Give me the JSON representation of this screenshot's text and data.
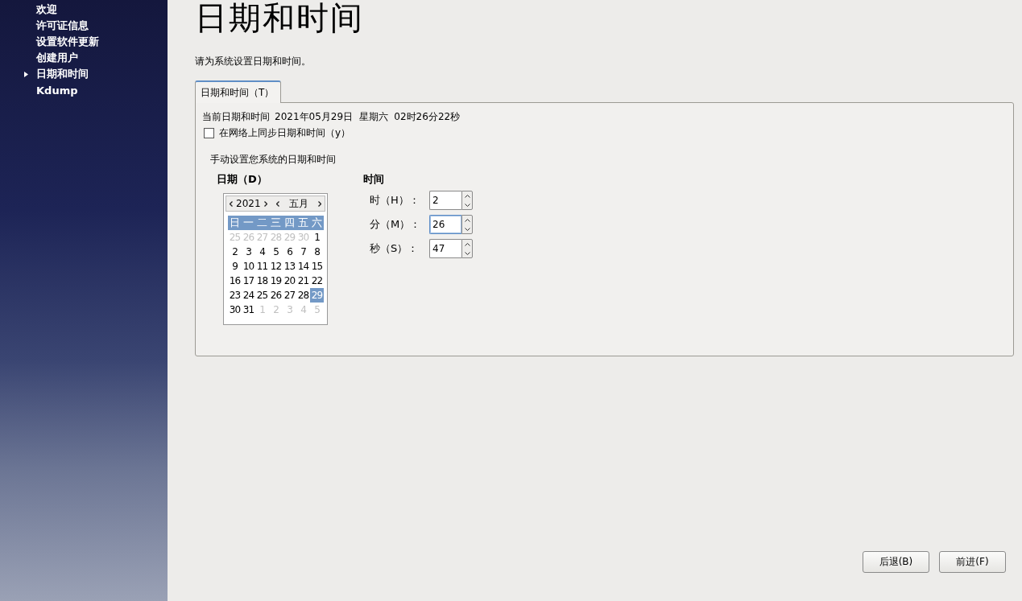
{
  "sidebar": {
    "items": [
      {
        "label": "欢迎",
        "selected": false
      },
      {
        "label": "许可证信息",
        "selected": false
      },
      {
        "label": "设置软件更新",
        "selected": false
      },
      {
        "label": "创建用户",
        "selected": false
      },
      {
        "label": "日期和时间",
        "selected": true
      },
      {
        "label": "Kdump",
        "selected": false
      }
    ]
  },
  "title": "日期和时间",
  "subtitle": "请为系统设置日期和时间。",
  "tabs": [
    {
      "label": "日期和时间（T）",
      "selected": true
    }
  ],
  "current": {
    "label": "当前日期和时间",
    "value": "2021年05月29日  星期六  02时26分22秒"
  },
  "sync": {
    "label": "在网络上同步日期和时间（y）",
    "checked": false
  },
  "manual_label": "手动设置您系统的日期和时间",
  "date": {
    "heading": "日期（D）",
    "year": "2021",
    "month": "五月",
    "weekdays": [
      "日",
      "一",
      "二",
      "三",
      "四",
      "五",
      "六"
    ],
    "days": [
      {
        "day": "25",
        "other": true,
        "selected": false
      },
      {
        "day": "26",
        "other": true,
        "selected": false
      },
      {
        "day": "27",
        "other": true,
        "selected": false
      },
      {
        "day": "28",
        "other": true,
        "selected": false
      },
      {
        "day": "29",
        "other": true,
        "selected": false
      },
      {
        "day": "30",
        "other": true,
        "selected": false
      },
      {
        "day": "1",
        "other": false,
        "selected": false
      },
      {
        "day": "2",
        "other": false,
        "selected": false
      },
      {
        "day": "3",
        "other": false,
        "selected": false
      },
      {
        "day": "4",
        "other": false,
        "selected": false
      },
      {
        "day": "5",
        "other": false,
        "selected": false
      },
      {
        "day": "6",
        "other": false,
        "selected": false
      },
      {
        "day": "7",
        "other": false,
        "selected": false
      },
      {
        "day": "8",
        "other": false,
        "selected": false
      },
      {
        "day": "9",
        "other": false,
        "selected": false
      },
      {
        "day": "10",
        "other": false,
        "selected": false
      },
      {
        "day": "11",
        "other": false,
        "selected": false
      },
      {
        "day": "12",
        "other": false,
        "selected": false
      },
      {
        "day": "13",
        "other": false,
        "selected": false
      },
      {
        "day": "14",
        "other": false,
        "selected": false
      },
      {
        "day": "15",
        "other": false,
        "selected": false
      },
      {
        "day": "16",
        "other": false,
        "selected": false
      },
      {
        "day": "17",
        "other": false,
        "selected": false
      },
      {
        "day": "18",
        "other": false,
        "selected": false
      },
      {
        "day": "19",
        "other": false,
        "selected": false
      },
      {
        "day": "20",
        "other": false,
        "selected": false
      },
      {
        "day": "21",
        "other": false,
        "selected": false
      },
      {
        "day": "22",
        "other": false,
        "selected": false
      },
      {
        "day": "23",
        "other": false,
        "selected": false
      },
      {
        "day": "24",
        "other": false,
        "selected": false
      },
      {
        "day": "25",
        "other": false,
        "selected": false
      },
      {
        "day": "26",
        "other": false,
        "selected": false
      },
      {
        "day": "27",
        "other": false,
        "selected": false
      },
      {
        "day": "28",
        "other": false,
        "selected": false
      },
      {
        "day": "29",
        "other": false,
        "selected": true
      },
      {
        "day": "30",
        "other": false,
        "selected": false
      },
      {
        "day": "31",
        "other": false,
        "selected": false
      },
      {
        "day": "1",
        "other": true,
        "selected": false
      },
      {
        "day": "2",
        "other": true,
        "selected": false
      },
      {
        "day": "3",
        "other": true,
        "selected": false
      },
      {
        "day": "4",
        "other": true,
        "selected": false
      },
      {
        "day": "5",
        "other": true,
        "selected": false
      }
    ]
  },
  "time": {
    "heading": "时间",
    "fields": [
      {
        "label": "时（H）：",
        "value": "2",
        "focused": false
      },
      {
        "label": "分（M）：",
        "value": "26",
        "focused": true
      },
      {
        "label": "秒（S）：",
        "value": "47",
        "focused": false
      }
    ]
  },
  "buttons": [
    "后退(B)",
    "前进(F)"
  ]
}
